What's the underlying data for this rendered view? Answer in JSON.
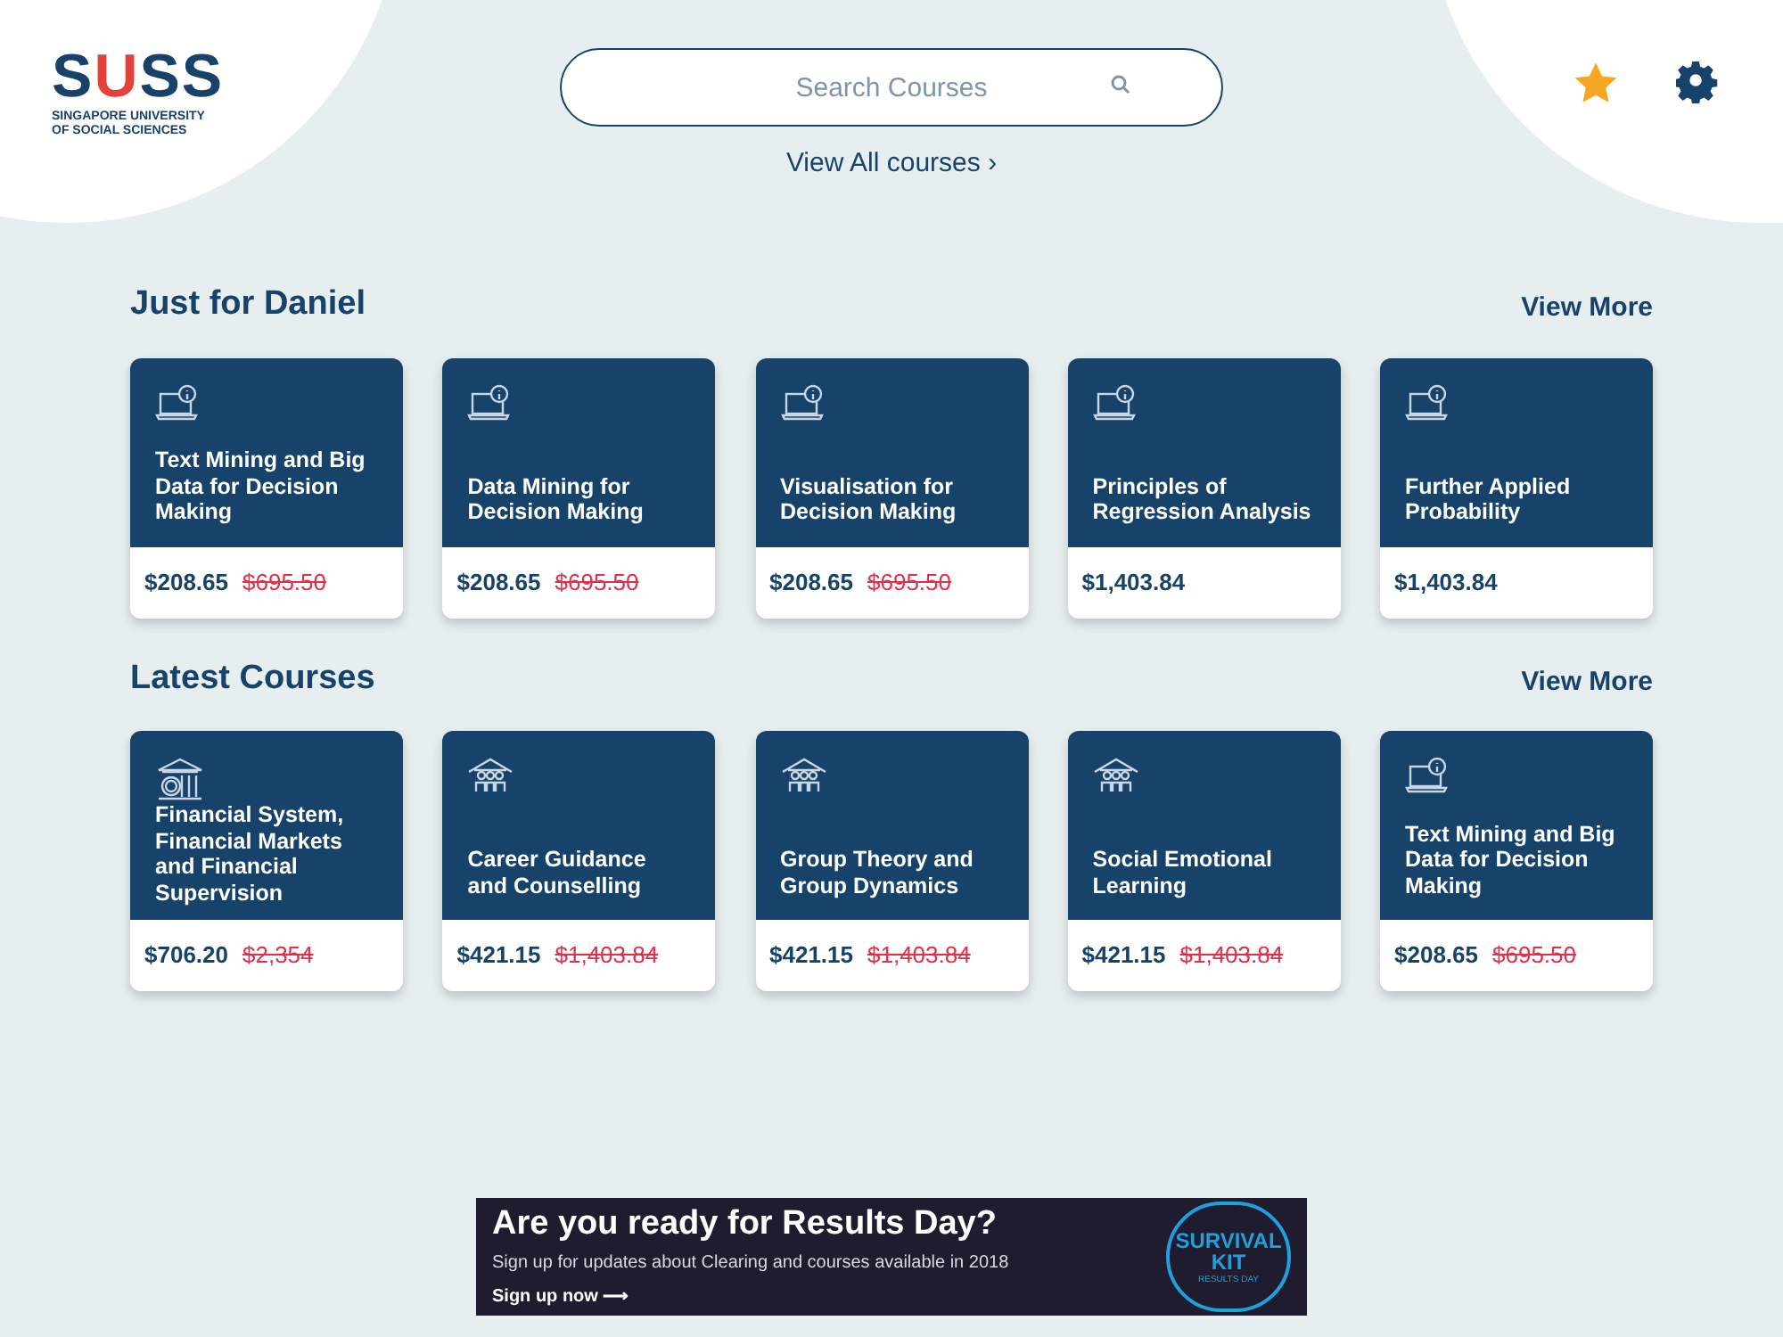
{
  "logo": {
    "mark_start": "S",
    "mark_accent": "U",
    "mark_end": "SS",
    "subtitle_lines": [
      "SINGAPORE UNIVERSITY",
      "OF SOCIAL SCIENCES"
    ]
  },
  "search": {
    "placeholder": "Search Courses"
  },
  "view_all": {
    "label": "View All courses",
    "arrow": "›"
  },
  "sections": [
    {
      "title": "Just for Daniel",
      "view_more": "View More",
      "courses": [
        {
          "kind": "laptop",
          "title": "Text Mining and Big Data for Decision Making",
          "price": "$208.65",
          "old_price": "$695.50"
        },
        {
          "kind": "laptop",
          "title": "Data Mining for Decision Making",
          "price": "$208.65",
          "old_price": "$695.50"
        },
        {
          "kind": "laptop",
          "title": "Visualisation for Decision Making",
          "price": "$208.65",
          "old_price": "$695.50"
        },
        {
          "kind": "laptop",
          "title": "Principles of Regression Analysis",
          "price": "$1,403.84"
        },
        {
          "kind": "laptop",
          "title": "Further Applied Probability",
          "price": "$1,403.84"
        }
      ]
    },
    {
      "title": "Latest Courses",
      "view_more": "View More",
      "courses": [
        {
          "kind": "bank",
          "title": "Financial System, Financial Markets and Financial Supervision",
          "price": "$706.20",
          "old_price": "$2,354"
        },
        {
          "kind": "people",
          "title": "Career Guidance and Counselling",
          "price": "$421.15",
          "old_price": "$1,403.84"
        },
        {
          "kind": "people",
          "title": "Group Theory and Group Dynamics",
          "price": "$421.15",
          "old_price": "$1,403.84"
        },
        {
          "kind": "people",
          "title": "Social Emotional Learning",
          "price": "$421.15",
          "old_price": "$1,403.84"
        },
        {
          "kind": "laptop",
          "title": "Text Mining and Big Data for Decision Making",
          "price": "$208.65",
          "old_price": "$695.50"
        }
      ]
    }
  ],
  "banner": {
    "headline": "Are you ready for Results Day?",
    "text": "Sign up for updates about Clearing and courses available in 2018",
    "cta": "Sign up now",
    "cta_arrow": "⟶",
    "badge_top": "SURVIVAL",
    "badge_bottom": "KIT",
    "badge_ring": "RESULTS DAY"
  }
}
